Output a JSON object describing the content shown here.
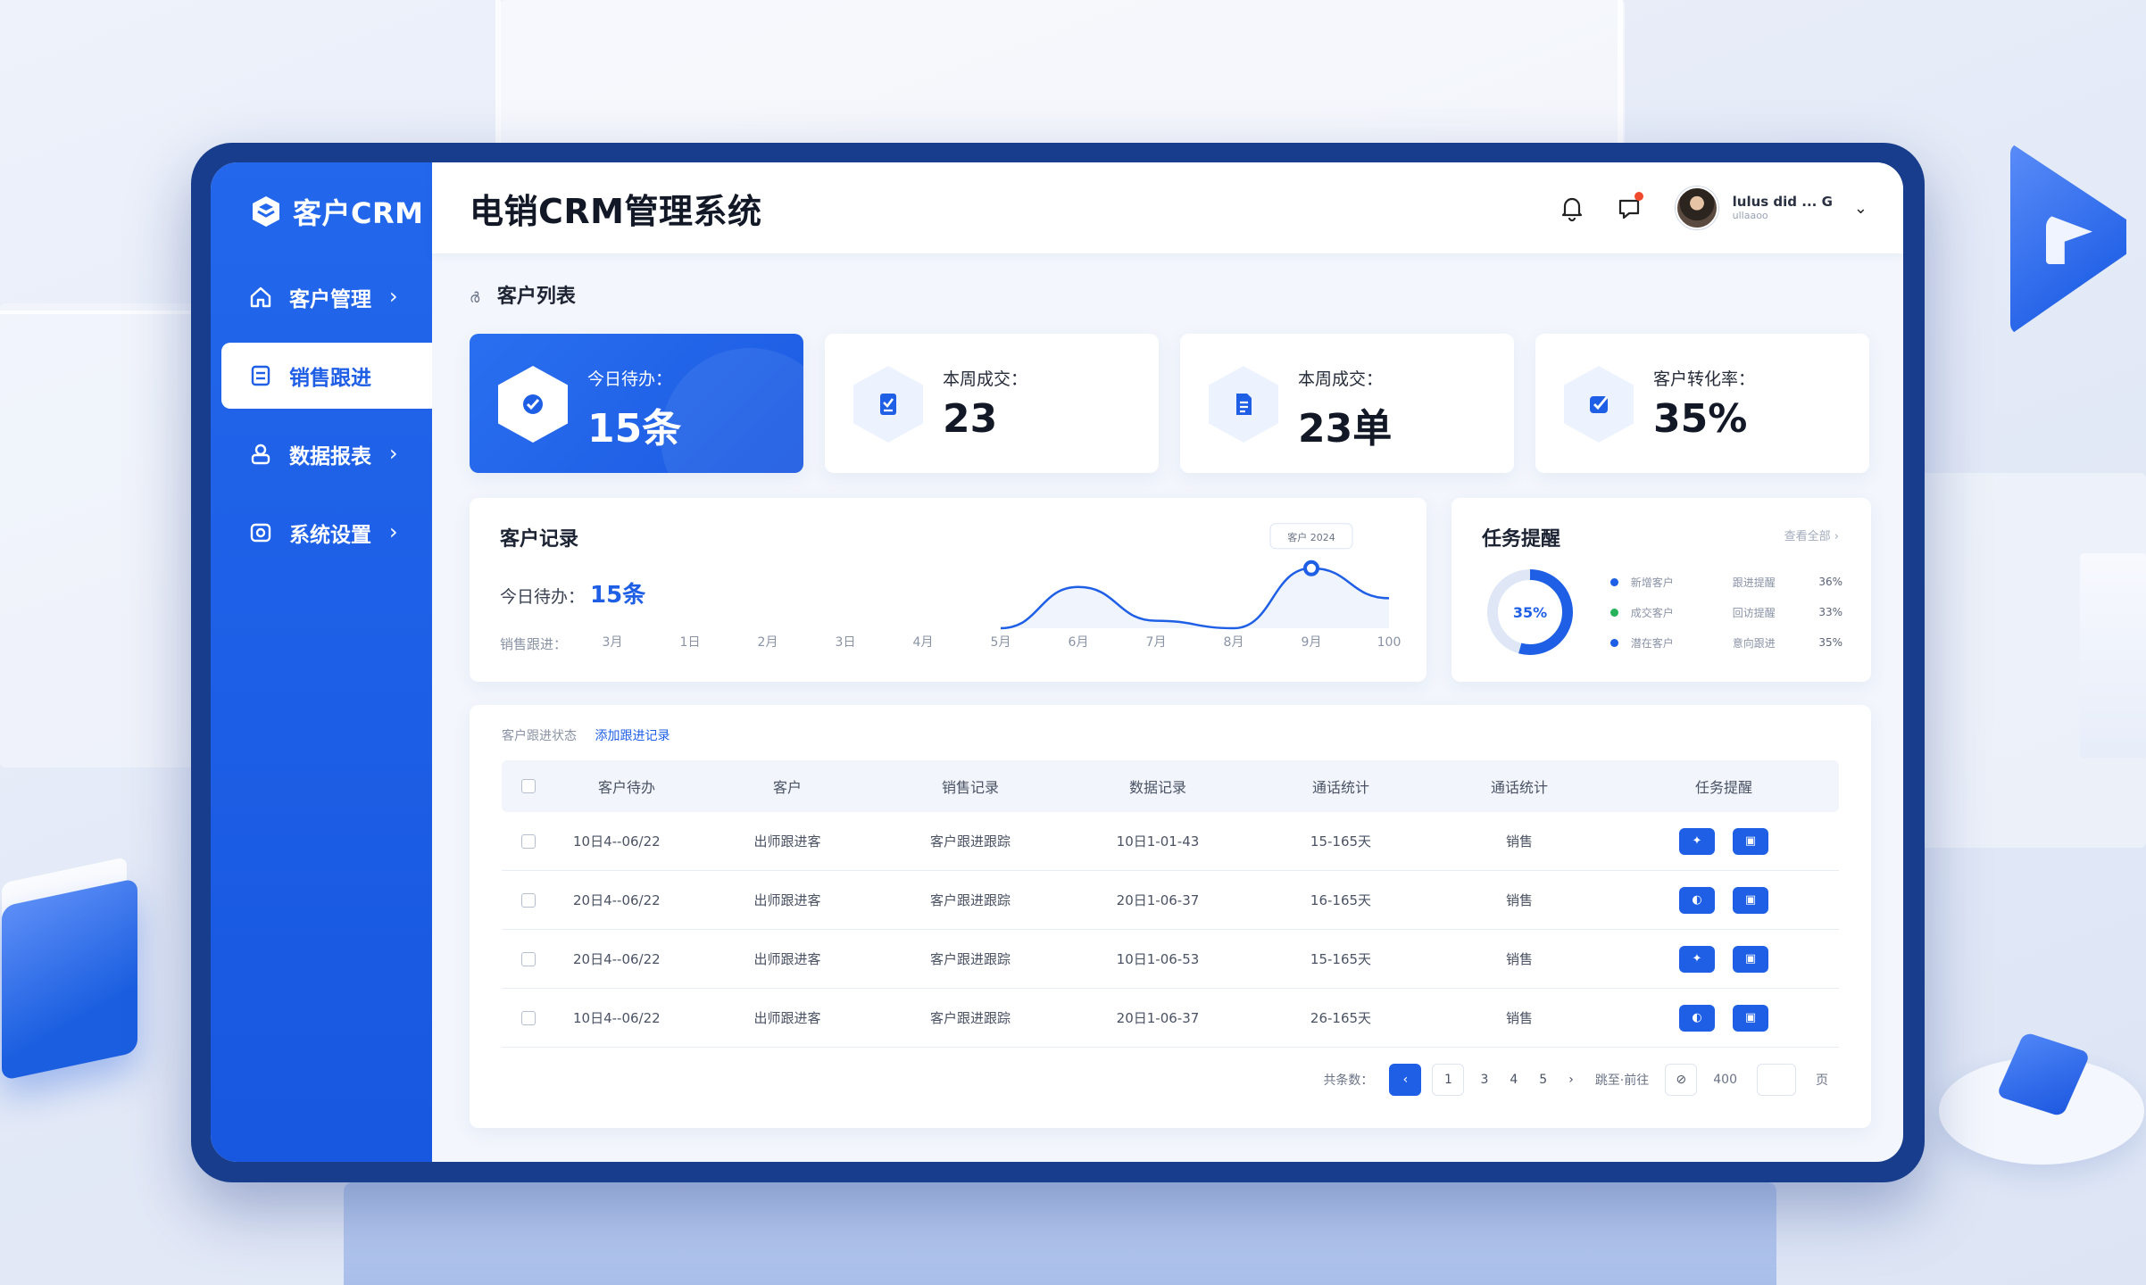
{
  "colors": {
    "primary": "#1f5fe6",
    "sidebar": "#1857e0",
    "success": "#27b35a",
    "alert_dot": "#f04a2c"
  },
  "brand": {
    "name": "客户CRM",
    "icon": "cube-logo-icon"
  },
  "sidebar": {
    "items": [
      {
        "label": "客户管理",
        "icon": "home-icon",
        "has_chevron": true,
        "active": false
      },
      {
        "label": "销售跟进",
        "icon": "document-icon",
        "has_chevron": false,
        "active": true
      },
      {
        "label": "数据报表",
        "icon": "user-icon",
        "has_chevron": true,
        "active": false
      },
      {
        "label": "系统设置",
        "icon": "settings-icon",
        "has_chevron": true,
        "active": false
      }
    ],
    "chevron": "›"
  },
  "header": {
    "title": "电销CRM管理系统",
    "user_name": "lulus did ... G",
    "user_sub": "ullaaoo",
    "chevron": "⌄"
  },
  "breadcrumb": {
    "icon": "ർ",
    "label": "客户列表"
  },
  "stats": [
    {
      "label": "今日待办：",
      "value": "15条",
      "icon": "task-icon"
    },
    {
      "label": "本周成交：",
      "value": "23",
      "icon": "clipboard-icon"
    },
    {
      "label": "本周成交：",
      "value": "23单",
      "icon": "file-icon"
    },
    {
      "label": "客户转化率：",
      "value": "35%",
      "icon": "check-shield-icon"
    }
  ],
  "records": {
    "title": "客户记录",
    "todo_label": "今日待办：",
    "todo_value": "15条",
    "xaxis_label": "销售跟进：",
    "tooltip": "客户 2024",
    "chart_data": {
      "type": "line",
      "x": [
        "3月",
        "1日",
        "2月",
        "3日",
        "4月",
        "5月",
        "6月",
        "7月",
        "8月",
        "9月",
        "100"
      ],
      "series": [
        {
          "values": [
            null,
            null,
            null,
            null,
            null,
            0,
            55,
            10,
            0,
            80,
            40
          ]
        }
      ],
      "highlight_index": 9,
      "grid": false
    }
  },
  "tasks": {
    "title": "任务提醒",
    "link": "查看全部",
    "link_chevron": "›",
    "donut_value": 0.35,
    "donut_label": "35%",
    "rows": [
      {
        "name": "新增客户",
        "detail": "跟进提醒",
        "pct": "36%",
        "color": "#1f5fe6"
      },
      {
        "name": "成交客户",
        "detail": "回访提醒",
        "pct": "33%",
        "color": "#27b35a"
      },
      {
        "name": "潜在客户",
        "detail": "意向跟进",
        "pct": "35%",
        "color": "#1f5fe6"
      }
    ]
  },
  "table": {
    "filter_label": "客户跟进状态",
    "filter_link": "添加跟进记录",
    "columns": [
      "客户待办",
      "客户",
      "销售记录",
      "数据记录",
      "通话统计",
      "通话统计",
      "任务提醒"
    ],
    "rows": [
      {
        "a": "10日4--06/22",
        "b": "出师跟进客",
        "c": "客户跟进跟踪",
        "d": "10日1-01-43",
        "e": "15-165天",
        "f": "销售",
        "act1": "✦",
        "act2": "▣"
      },
      {
        "a": "20日4--06/22",
        "b": "出师跟进客",
        "c": "客户跟进跟踪",
        "d": "20日1-06-37",
        "e": "16-165天",
        "f": "销售",
        "act1": "◐",
        "act2": "▣"
      },
      {
        "a": "20日4--06/22",
        "b": "出师跟进客",
        "c": "客户跟进跟踪",
        "d": "10日1-06-53",
        "e": "15-165天",
        "f": "销售",
        "act1": "✦",
        "act2": "▣"
      },
      {
        "a": "10日4--06/22",
        "b": "出师跟进客",
        "c": "客户跟进跟踪",
        "d": "20日1-06-37",
        "e": "26-165天",
        "f": "销售",
        "act1": "◐",
        "act2": "▣"
      }
    ]
  },
  "pagination": {
    "total_label": "共条数：",
    "prev": "‹",
    "pages": [
      "1",
      "3",
      "4",
      "5"
    ],
    "next": "›",
    "goto_label": "跳至·前往",
    "size_icon": "⊘",
    "size_value": "400",
    "page_unit": "页"
  }
}
